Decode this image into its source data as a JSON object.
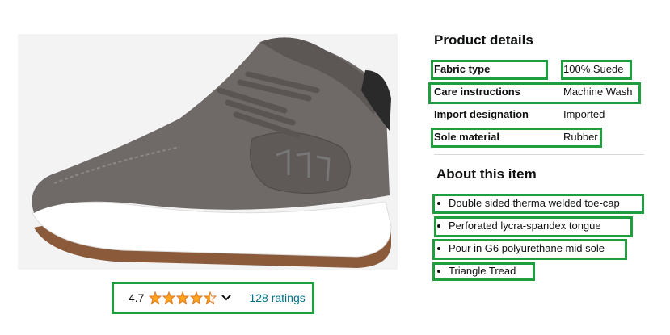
{
  "product": {
    "image_alt_icon": "sneaker-image"
  },
  "rating": {
    "value": "4.7",
    "stars": 4.5,
    "ratings_label": "128 ratings"
  },
  "product_details": {
    "title": "Product details",
    "rows": [
      {
        "label": "Fabric type",
        "value": "100% Suede"
      },
      {
        "label": "Care instructions",
        "value": "Machine Wash"
      },
      {
        "label": "Import designation",
        "value": "Imported"
      },
      {
        "label": "Sole material",
        "value": "Rubber"
      }
    ]
  },
  "about": {
    "title": "About this item",
    "bullets": [
      "Double sided therma welded toe-cap",
      "Perforated lycra-spandex tongue",
      "Pour in G6 polyurethane mid sole",
      "Triangle Tread"
    ]
  },
  "colors": {
    "highlight": "#1e9e3e",
    "star": "#ffa41c",
    "link": "#007185"
  }
}
